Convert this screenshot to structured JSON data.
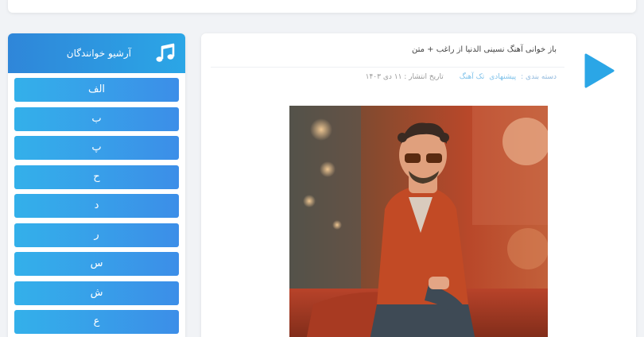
{
  "sidebar": {
    "title": "آرشیو خوانندگان",
    "letters": [
      "الف",
      "ب",
      "پ",
      "ح",
      "د",
      "ر",
      "س",
      "ش",
      "ع"
    ]
  },
  "post": {
    "title": "باز خوانی آهنگ نسینی الدنیا از راغب + متن",
    "category_label": "دسته بندی :",
    "category_1": "پیشنهادی",
    "category_2": "تک آهنگ",
    "date": "تاریخ انتشار : ۱۱ دی ۱۴۰۳"
  },
  "colors": {
    "accent": "#2ba6e6",
    "button_gradient_start": "#33b0ea",
    "button_gradient_end": "#3c8ee8"
  },
  "icons": {
    "header": "music-note-icon",
    "play": "play-icon"
  }
}
